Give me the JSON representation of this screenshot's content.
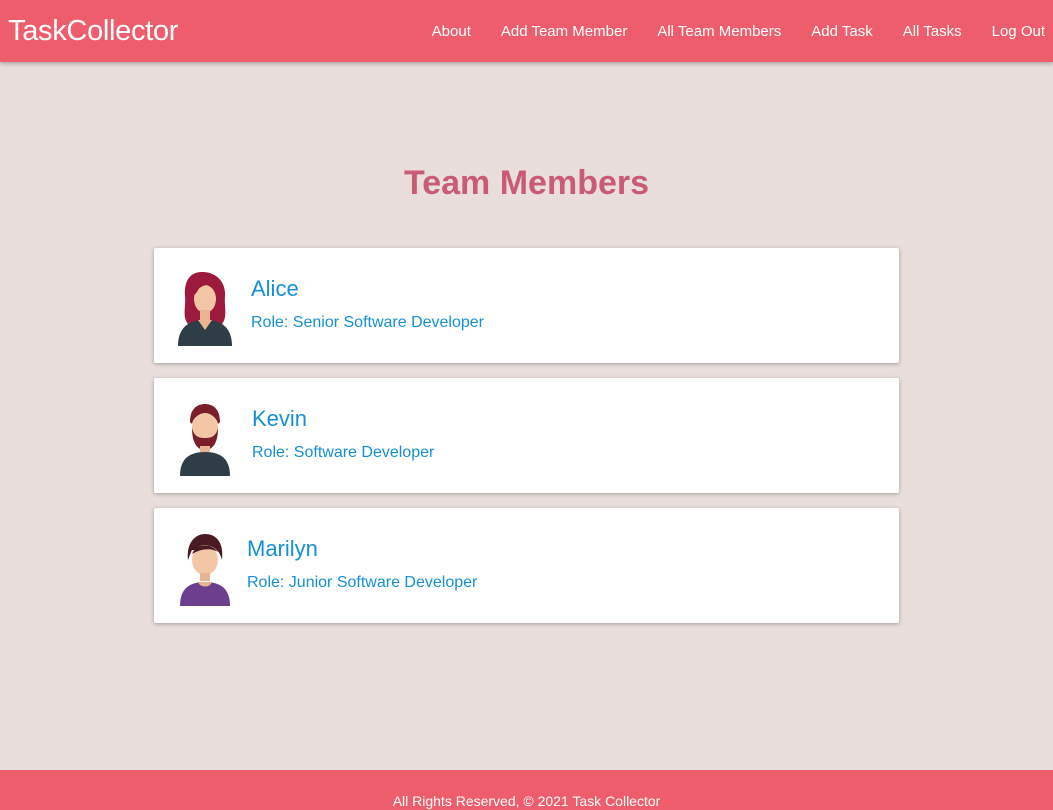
{
  "header": {
    "brand": "TaskCollector",
    "nav": [
      {
        "label": "About"
      },
      {
        "label": "Add Team Member"
      },
      {
        "label": "All Team Members"
      },
      {
        "label": "Add Task"
      },
      {
        "label": "All Tasks"
      },
      {
        "label": "Log Out"
      }
    ]
  },
  "main": {
    "title": "Team Members",
    "members": [
      {
        "name": "Alice",
        "role": "Role: Senior Software Developer",
        "avatar": "female-avatar-icon"
      },
      {
        "name": "Kevin",
        "role": "Role: Software Developer",
        "avatar": "bearded-male-avatar-icon"
      },
      {
        "name": "Marilyn",
        "role": "Role: Junior Software Developer",
        "avatar": "short-hair-avatar-icon"
      }
    ]
  },
  "footer": {
    "text": "All Rights Reserved, © 2021 Task Collector"
  },
  "colors": {
    "header_bg": "#ee5d6c",
    "page_bg": "#e9dedb",
    "title": "#c95b74",
    "link": "#1590d4"
  }
}
